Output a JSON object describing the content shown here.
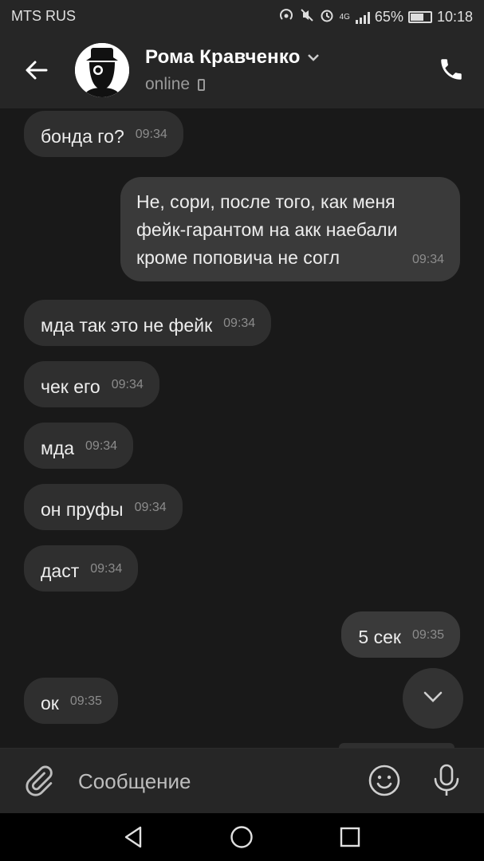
{
  "status_bar": {
    "carrier": "MTS RUS",
    "network": "4G",
    "battery": "65%",
    "battery_level": 0.65,
    "time": "10:18"
  },
  "header": {
    "contact_name": "Рома Кравченко",
    "presence": "online",
    "icons": [
      "back-arrow-icon",
      "chevron-down-icon",
      "phone-device-icon",
      "call-icon"
    ]
  },
  "messages": [
    {
      "dir": "in",
      "text": "бонда го?",
      "time": "09:34"
    },
    {
      "dir": "out",
      "text": "Не, сори, после того, как меня фейк-гарантом на акк наебали кроме поповича не согл",
      "time": "09:34"
    },
    {
      "dir": "in",
      "text": "мда так это не фейк",
      "time": "09:34"
    },
    {
      "dir": "in",
      "text": "чек его",
      "time": "09:34"
    },
    {
      "dir": "in",
      "text": "мда",
      "time": "09:34"
    },
    {
      "dir": "in",
      "text": "он пруфы",
      "time": "09:34"
    },
    {
      "dir": "in",
      "text": "даст",
      "time": "09:34"
    },
    {
      "dir": "out",
      "text": "5 сек",
      "time": "09:35"
    },
    {
      "dir": "in",
      "text": "ок",
      "time": "09:35"
    }
  ],
  "composer": {
    "placeholder": "Сообщение",
    "icons": [
      "paperclip-icon",
      "emoji-icon",
      "microphone-icon"
    ]
  },
  "navigation": {
    "icons": [
      "nav-back-icon",
      "nav-home-icon",
      "nav-recents-icon"
    ]
  },
  "colors": {
    "background": "#191919",
    "bar": "#262626",
    "bubble_in": "#2f2f2f",
    "bubble_out": "#3a3a3a",
    "time_text": "#8c8c8c"
  }
}
